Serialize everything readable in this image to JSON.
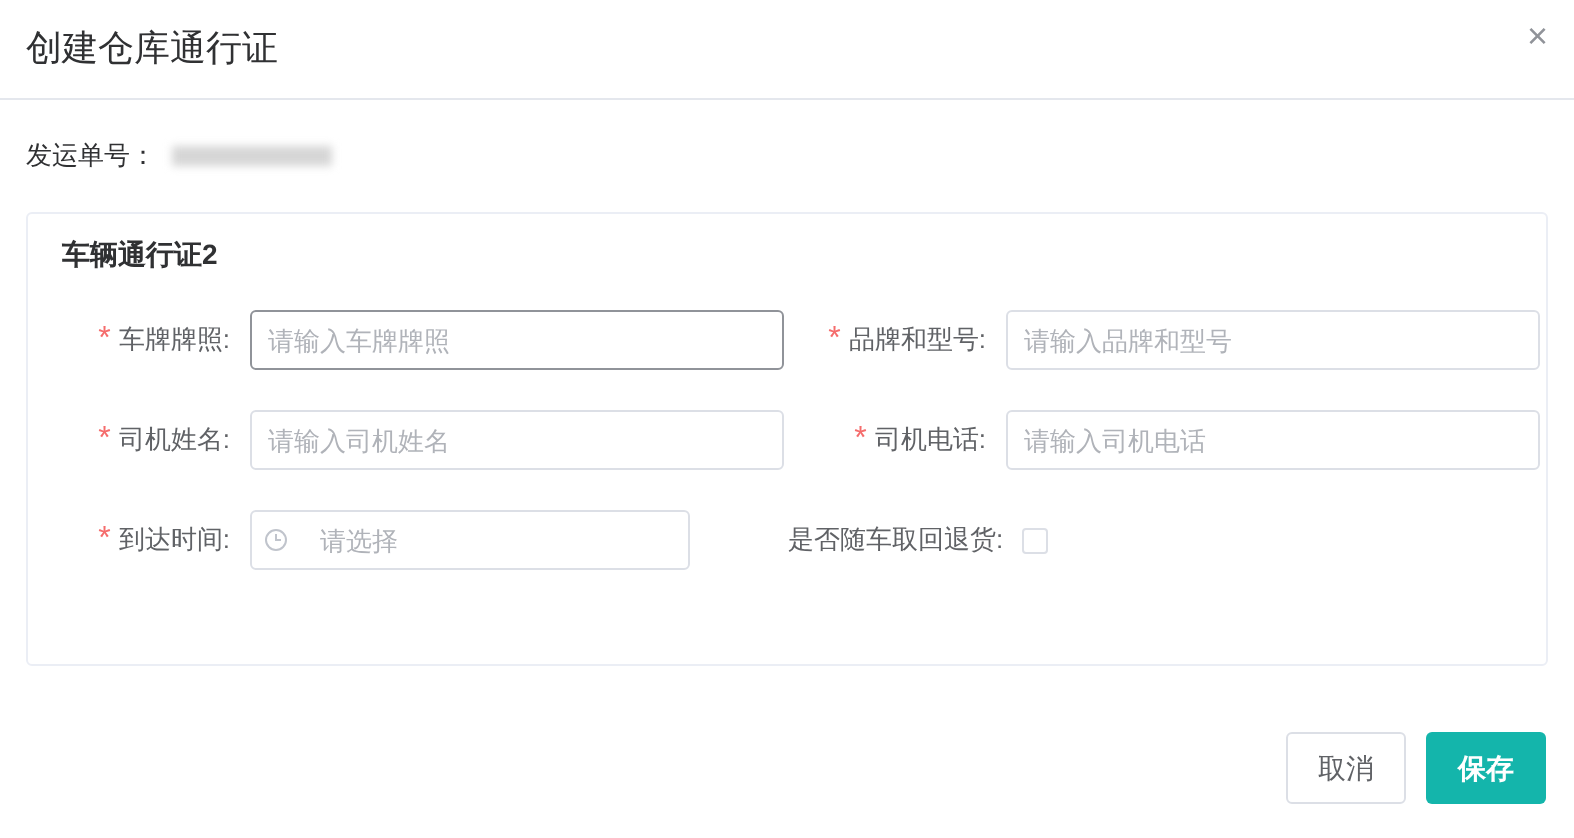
{
  "dialog": {
    "title": "创建仓库通行证",
    "close": "×"
  },
  "shipment": {
    "label": "发运单号："
  },
  "card": {
    "title": "车辆通行证2",
    "fields": [
      {
        "kind": "text",
        "label": "车牌牌照:",
        "required_mark": "*",
        "placeholder": "请输入车牌牌照",
        "focused": true
      },
      {
        "kind": "text",
        "label": "品牌和型号:",
        "required_mark": "*",
        "placeholder": "请输入品牌和型号",
        "focused": false
      },
      {
        "kind": "text",
        "label": "司机姓名:",
        "required_mark": "*",
        "placeholder": "请输入司机姓名",
        "focused": false
      },
      {
        "kind": "text",
        "label": "司机电话:",
        "required_mark": "*",
        "placeholder": "请输入司机电话",
        "focused": false
      },
      {
        "kind": "date",
        "label": "到达时间:",
        "required_mark": "*",
        "placeholder": "请选择",
        "focused": false
      },
      {
        "kind": "checkbox",
        "label": "是否随车取回退货:",
        "checked": false
      }
    ]
  },
  "buttons": [
    {
      "label": "取消",
      "kind": "secondary"
    },
    {
      "label": "保存",
      "kind": "primary"
    }
  ]
}
